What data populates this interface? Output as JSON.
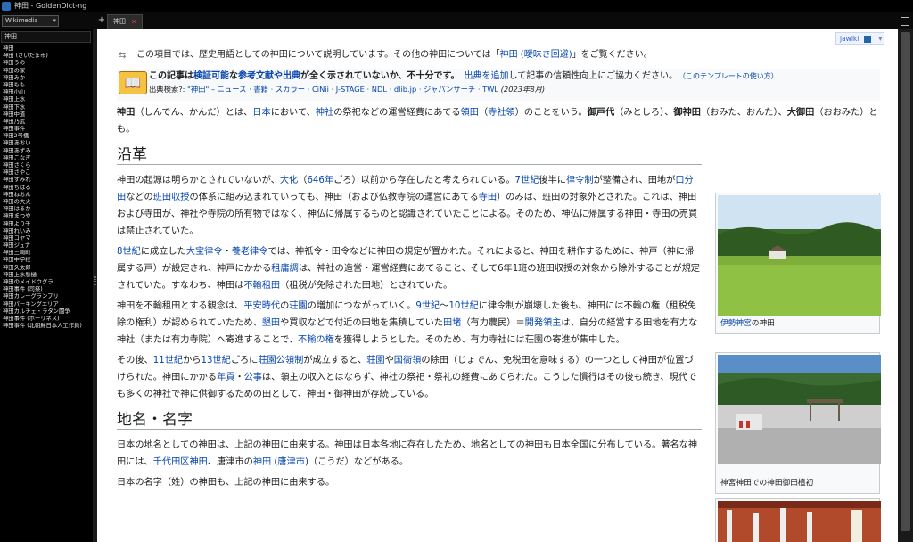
{
  "window": {
    "title": "神田 - GoldenDict-ng"
  },
  "toolbar": {
    "dictionary": "Wikimedia",
    "new_tab": "+",
    "tab_label": "神田",
    "tab_close": "✕"
  },
  "sidebar": {
    "query": "神田",
    "words": [
      "神田",
      "神田 (さいたま市)",
      "神田うの",
      "神田の家",
      "神田みか",
      "神田もも",
      "神田小山",
      "神田上水",
      "神田下水",
      "神田中道",
      "神田乃武",
      "神田事件",
      "神田2号橋",
      "神田あおい",
      "神田あずみ",
      "神田こなぎ",
      "神田さくら",
      "神田さやこ",
      "神田すみれ",
      "神田ちはる",
      "神田ねおん",
      "神田の大火",
      "神田はるか",
      "神田まつや",
      "神田より子",
      "神田れいみ",
      "神田コヤマ",
      "神田ジュナ",
      "神田三崎町",
      "神田中学校",
      "神田久太郎",
      "神田上水懸樋",
      "神田のメイドウグラ",
      "神田事件 (司祭)",
      "神田カレーグランプリ",
      "神田パーキングエリア",
      "神田カルチェ・ラタン闘争",
      "神田事件 (ホーリネス)",
      "神田事件 (北朝鮮日本人工作員)"
    ]
  },
  "article": {
    "jawiki": "jawiki",
    "hatnote": {
      "pre": "この項目では、歴史用語としての神田について説明しています。その他の神田については「",
      "link": "神田 (曖昧さ回避)",
      "post": "」をご覧ください。"
    },
    "ambox": {
      "p1": "この記事は",
      "l1": "検証可能",
      "p2": "な",
      "l2": "参考文献や出典",
      "p3": "が全く示されていないか、不十分です。",
      "l3": "出典を追加",
      "p4": "して記事の信頼性向上にご協力ください。",
      "l4": "（このテンプレートの使い方）",
      "src_label": "出典検索?: ",
      "src_links": "\"神田\" – ニュース · 書籍 · スカラー · CiNii · J-STAGE · NDL · dlib.jp · ジャパンサーチ · TWL",
      "date": "(2023年8月)"
    },
    "lead": {
      "b1": "神田",
      "t1": "（しんでん、かんだ）とは、",
      "l1": "日本",
      "t2": "において、",
      "l2": "神社",
      "t3": "の祭祀などの運営経費にあてる",
      "l3": "領田",
      "t4": "（",
      "l4": "寺社領",
      "t5": "）のことをいう。",
      "b2": "御戸代",
      "t6": "（みとしろ）、",
      "b3": "御神田",
      "t7": "（おみた、おんた）、",
      "b4": "大御田",
      "t8": "（おおみた）とも。"
    },
    "h_history": "沿革",
    "p1": {
      "t1": "神田の起源は明らかとされていないが、",
      "l1": "大化",
      "t2": "（",
      "l2": "646年",
      "t3": "ごろ）以前から存在したと考えられている。",
      "l3": "7世紀",
      "t4": "後半に",
      "l4": "律令制",
      "t5": "が整備され、田地が",
      "l5": "口分田",
      "t6": "などの",
      "l6": "班田収授",
      "t7": "の体系に組み込まれていっても、神田（および仏教寺院の運営にあてる",
      "l7": "寺田",
      "t8": "）のみは、班田の対象外とされた。これは、神田および寺田が、神社や寺院の所有物ではなく、神仏に帰属するものと認識されていたことによる。そのため、神仏に帰属する神田・寺田の売買は禁止されていた。"
    },
    "p2": {
      "l1": "8世紀",
      "t1": "に成立した",
      "l2": "大宝律令",
      "t2": "・",
      "l3": "養老律令",
      "t3": "では、神祇令・田令などに神田の規定が置かれた。それによると、神田を耕作するために、神戸（神に帰属する戸）が設定され、神戸にかかる",
      "l4": "租庸調",
      "t4": "は、神社の造営・運営経費にあてること、そして6年1班の班田収授の対象から除外することが規定されていた。すなわち、神田は",
      "l5": "不輸租田",
      "t5": "（租税が免除された田地）とされていた。"
    },
    "p3": {
      "t1": "神田を不輸租田とする観念は、",
      "l1": "平安時代",
      "t2": "の",
      "l2": "荘園",
      "t3": "の増加につながっていく。",
      "l3": "9世紀",
      "t4": "～",
      "l4": "10世紀",
      "t5": "に律令制が崩壊した後も、神田には不輸の権（租税免除の権利）が認められていたため、",
      "l5": "墾田",
      "t6": "や買収などで付近の田地を集積していた",
      "l6": "田堵",
      "t7": "（有力農民）＝",
      "l7": "開発領主",
      "t8": "は、自分の経営する田地を有力な神社（または有力寺院）へ寄進することで、",
      "l8": "不輸の権",
      "t9": "を獲得しようとした。そのため、有力寺社には荘園の寄進が集中した。"
    },
    "p4": {
      "t1": "その後、",
      "l1": "11世紀",
      "t2": "から",
      "l2": "13世紀",
      "t3": "ごろに",
      "l3": "荘園公領制",
      "t4": "が成立すると、",
      "l4": "荘園",
      "t5": "や",
      "l5": "国衙領",
      "t6": "の除田（じょでん、免税田を意味する）の一つとして神田が位置づけられた。神田にかかる",
      "l6": "年貢",
      "t7": "・",
      "l7": "公事",
      "t8": "は、領主の収入とはならず、神社の祭祀・祭礼の経費にあてられた。こうした慣行はその後も続き、現代でも多くの神社で神に供御するための田として、神田・御神田が存続している。"
    },
    "h_names": "地名・名字",
    "p5": {
      "t1": "日本の地名としての神田は、上記の神田に由来する。神田は日本各地に存在したため、地名としての神田も日本全国に分布している。著名な神田には、",
      "l1": "千代田区神田",
      "t2": "、唐津市の",
      "l2": "神田 (唐津市)",
      "t3": "（こうだ）などがある。"
    },
    "p6": "日本の名字（姓）の神田も、上記の神田に由来する。",
    "thumb1": {
      "link": "伊勢神宮",
      "text": "の神田"
    },
    "thumb2": {
      "text": "神宮神田での神田御田植初"
    }
  }
}
